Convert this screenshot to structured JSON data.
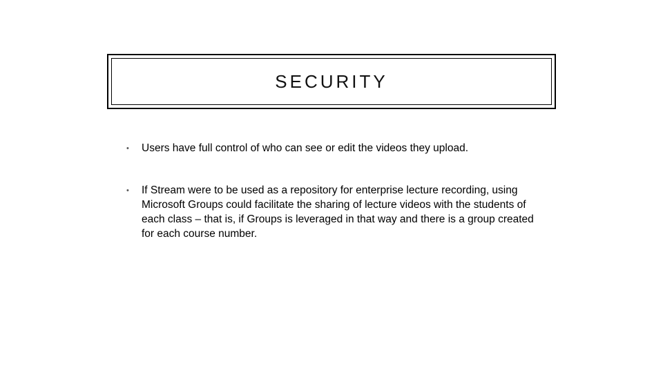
{
  "slide": {
    "title": "SECURITY",
    "bullets": [
      "Users have full control of who can see or edit the videos they upload.",
      "If Stream were to be used as a repository for enterprise lecture recording, using Microsoft Groups could facilitate the sharing of lecture videos with the students of each class – that is, if Groups is leveraged in that way and there is a group created for each course number."
    ]
  }
}
